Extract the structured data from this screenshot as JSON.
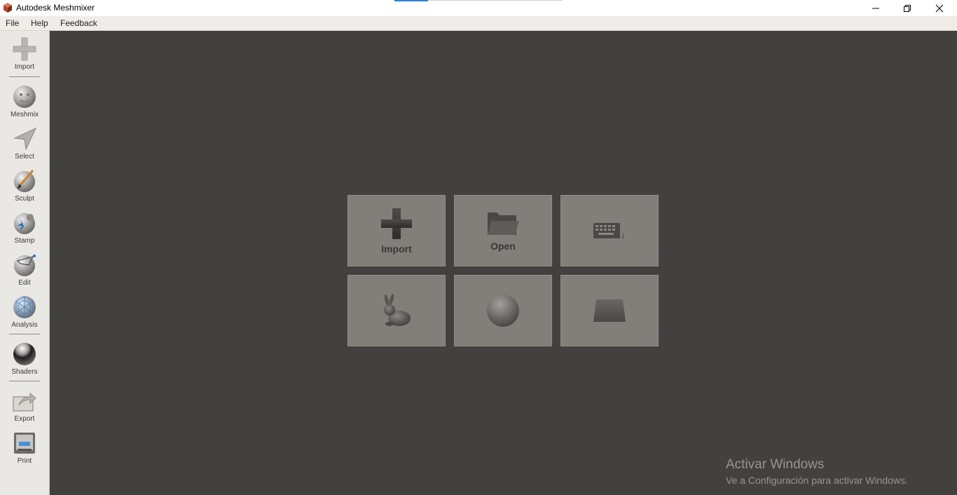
{
  "window": {
    "title": "Autodesk Meshmixer",
    "icons": [
      "app-logo-icon",
      "minimize-icon",
      "maximize-icon",
      "close-icon"
    ]
  },
  "menu": {
    "file": "File",
    "help": "Help",
    "feedback": "Feedback"
  },
  "toolbar": {
    "import": "Import",
    "meshmix": "Meshmix",
    "select": "Select",
    "sculpt": "Sculpt",
    "stamp": "Stamp",
    "edit": "Edit",
    "analysis": "Analysis",
    "shaders": "Shaders",
    "export": "Export",
    "print": "Print"
  },
  "start_tiles": {
    "import": "Import",
    "open": "Open",
    "icons": [
      "plus-icon",
      "folder-icon",
      "keyboard-icon",
      "bunny-icon",
      "sphere-icon",
      "plane-icon"
    ]
  },
  "watermark": {
    "title": "Activar Windows",
    "subtitle": "Ve a Configuración para activar Windows."
  },
  "colors": {
    "viewport_bg": "#434140",
    "tile_bg": "#827f7b",
    "toolbar_bg": "#eae8e5"
  }
}
